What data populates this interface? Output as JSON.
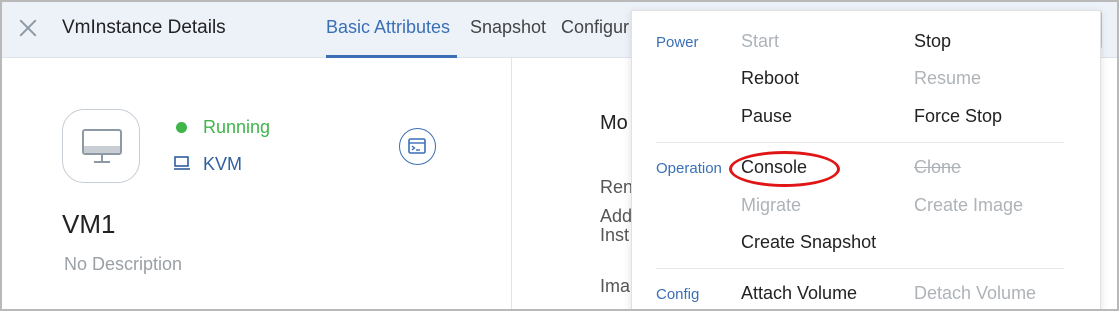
{
  "header": {
    "title": "VmInstance Details",
    "tabs": [
      {
        "label": "Basic Attributes",
        "active": true
      },
      {
        "label": "Snapshot",
        "active": false
      },
      {
        "label": "Configur",
        "active": false
      }
    ]
  },
  "vm": {
    "status": "Running",
    "hypervisor": "KVM",
    "name": "VM1",
    "description": "No Description"
  },
  "right_panel": {
    "heading": "Mo",
    "row1": "Ren",
    "row2a": "Add",
    "row2b": "Inst",
    "row3": "Ima"
  },
  "menu": {
    "groups": {
      "power": "Power",
      "operation": "Operation",
      "config": "Config"
    },
    "items": {
      "start": "Start",
      "stop": "Stop",
      "reboot": "Reboot",
      "resume": "Resume",
      "pause": "Pause",
      "force_stop": "Force Stop",
      "console": "Console",
      "clone": "Clone",
      "migrate": "Migrate",
      "create_image": "Create Image",
      "create_snapshot": "Create Snapshot",
      "attach_volume": "Attach Volume",
      "detach_volume": "Detach Volume"
    }
  },
  "colors": {
    "accent": "#3a6fb6",
    "running": "#3fb54a",
    "disabled": "#aeb3b8",
    "highlight": "#e01515"
  }
}
